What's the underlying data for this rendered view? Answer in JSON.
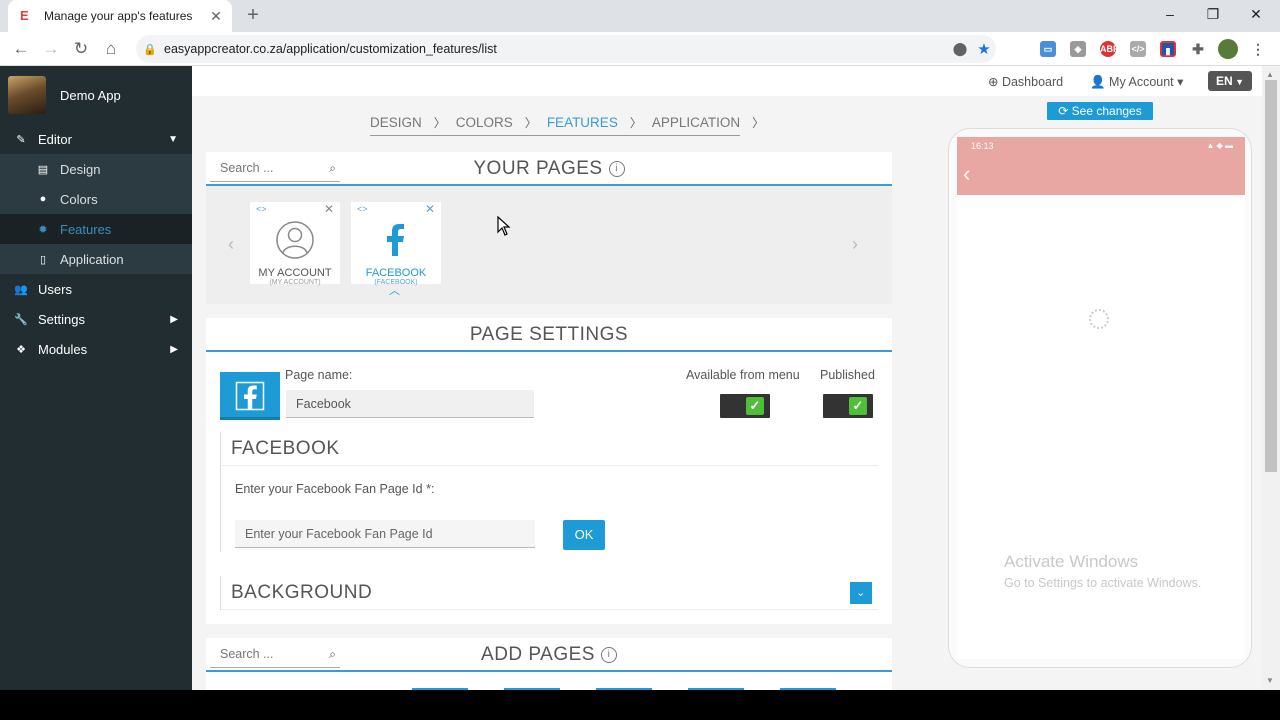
{
  "browser": {
    "tab_title": "Manage your app's features",
    "url": "easyappcreator.co.za/application/customization_features/list"
  },
  "sidebar": {
    "app_name": "Demo App",
    "items": [
      {
        "label": "Editor",
        "icon": "pencil-icon"
      },
      {
        "label": "Design",
        "icon": "layout-icon"
      },
      {
        "label": "Colors",
        "icon": "palette-icon"
      },
      {
        "label": "Features",
        "icon": "gear-icon"
      },
      {
        "label": "Application",
        "icon": "mobile-icon"
      },
      {
        "label": "Users",
        "icon": "users-icon"
      },
      {
        "label": "Settings",
        "icon": "wrench-icon"
      },
      {
        "label": "Modules",
        "icon": "cubes-icon"
      }
    ]
  },
  "topbar": {
    "dashboard": "Dashboard",
    "my_account": "My Account",
    "language": "EN"
  },
  "steps": [
    "DESIGN",
    "COLORS",
    "FEATURES",
    "APPLICATION"
  ],
  "your_pages": {
    "search_placeholder": "Search ...",
    "title": "YOUR PAGES",
    "cards": [
      {
        "label": "MY ACCOUNT",
        "sub": "(MY ACCOUNT)"
      },
      {
        "label": "FACEBOOK",
        "sub": "(FACEBOOK)"
      }
    ]
  },
  "page_settings": {
    "title": "PAGE SETTINGS",
    "page_name_label": "Page name:",
    "page_name_value": "Facebook",
    "available_label": "Available from menu",
    "published_label": "Published",
    "facebook_section": "FACEBOOK",
    "fan_page_label": "Enter your Facebook Fan Page Id *:",
    "fan_page_placeholder": "Enter your Facebook Fan Page Id",
    "ok_label": "OK",
    "background_section": "BACKGROUND"
  },
  "add_pages": {
    "search_placeholder": "Search ...",
    "title": "ADD PAGES"
  },
  "preview": {
    "see_changes": "See changes",
    "time": "16:13"
  },
  "watermark": {
    "line1": "Activate Windows",
    "line2": "Go to Settings to activate Windows."
  }
}
